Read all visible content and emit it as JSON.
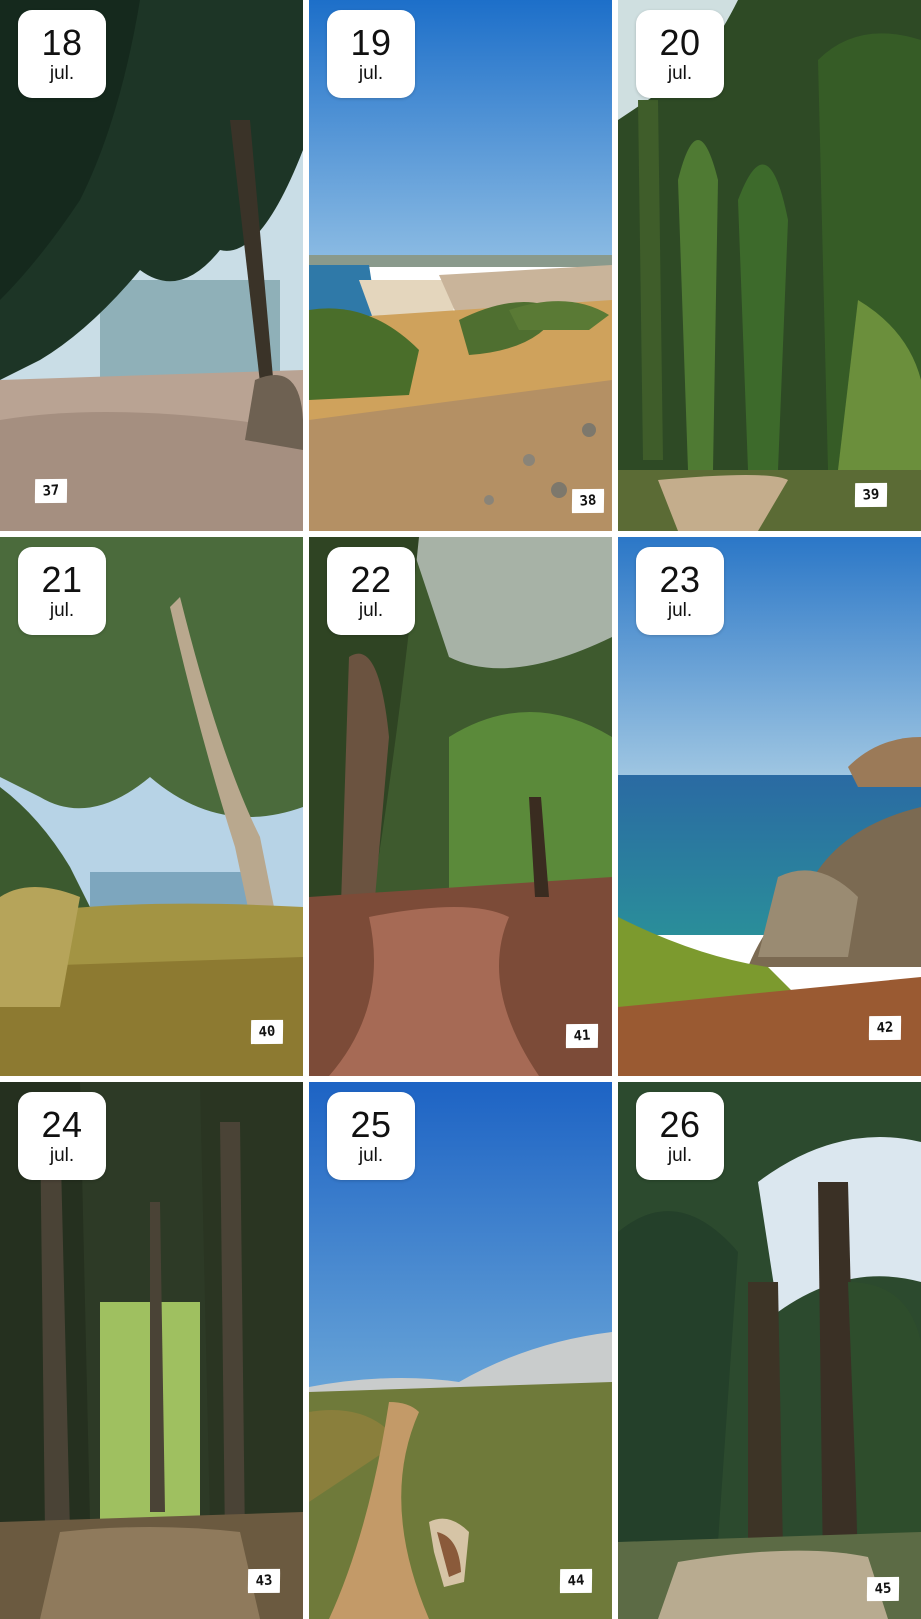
{
  "tiles": [
    {
      "day": "18",
      "month": "jul.",
      "number": "37"
    },
    {
      "day": "19",
      "month": "jul.",
      "number": "38"
    },
    {
      "day": "20",
      "month": "jul.",
      "number": "39"
    },
    {
      "day": "21",
      "month": "jul.",
      "number": "40"
    },
    {
      "day": "22",
      "month": "jul.",
      "number": "41"
    },
    {
      "day": "23",
      "month": "jul.",
      "number": "42"
    },
    {
      "day": "24",
      "month": "jul.",
      "number": "43"
    },
    {
      "day": "25",
      "month": "jul.",
      "number": "44"
    },
    {
      "day": "26",
      "month": "jul.",
      "number": "45"
    }
  ]
}
